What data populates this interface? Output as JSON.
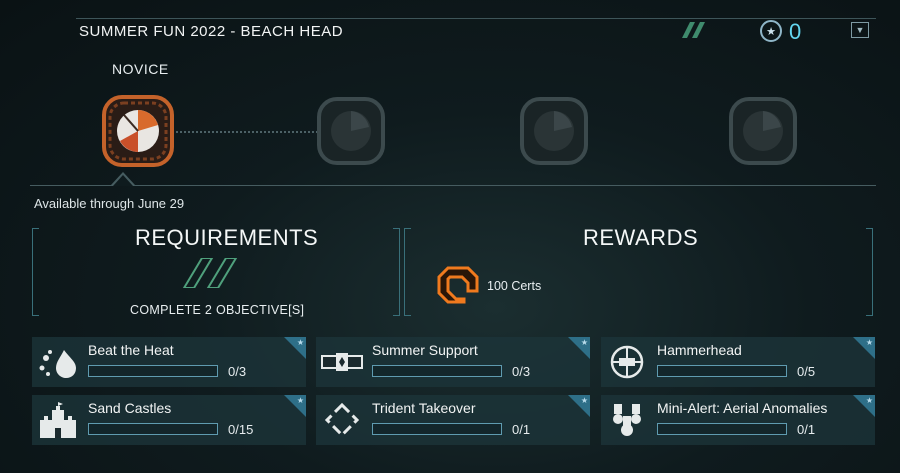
{
  "header": {
    "title": "SUMMER FUN 2022 - BEACH HEAD",
    "star_count": "0",
    "icons": [
      "slashes-icon",
      "star-badge-icon",
      "dropdown-icon"
    ]
  },
  "tiers": [
    {
      "label": "NOVICE",
      "state": "active"
    },
    {
      "label": "",
      "state": "locked"
    },
    {
      "label": "",
      "state": "locked"
    },
    {
      "label": "",
      "state": "locked"
    }
  ],
  "availability": "Available through June 29",
  "requirements": {
    "title": "REQUIREMENTS",
    "text": "COMPLETE 2 OBJECTIVE[S]"
  },
  "rewards": {
    "title": "REWARDS",
    "item": "100 Certs"
  },
  "objectives": [
    {
      "name": "Beat the Heat",
      "progress": "0/3",
      "icon": "splash-icon",
      "fraction": 0
    },
    {
      "name": "Summer Support",
      "progress": "0/3",
      "icon": "support-icon",
      "fraction": 0
    },
    {
      "name": "Hammerhead",
      "progress": "0/5",
      "icon": "crosshair-icon",
      "fraction": 0
    },
    {
      "name": "Sand Castles",
      "progress": "0/15",
      "icon": "castle-icon",
      "fraction": 0
    },
    {
      "name": "Trident Takeover",
      "progress": "0/1",
      "icon": "diamond-icon",
      "fraction": 0
    },
    {
      "name": "Mini-Alert: Aerial Anomalies",
      "progress": "0/1",
      "icon": "medals-icon",
      "fraction": 0
    }
  ],
  "colors": {
    "accent": "#63d6f0",
    "bar_border": "#5f9bb0",
    "card_bg": "#1c343a",
    "reward_orange": "#f07a1e",
    "requirement_green": "#4fa07c"
  }
}
